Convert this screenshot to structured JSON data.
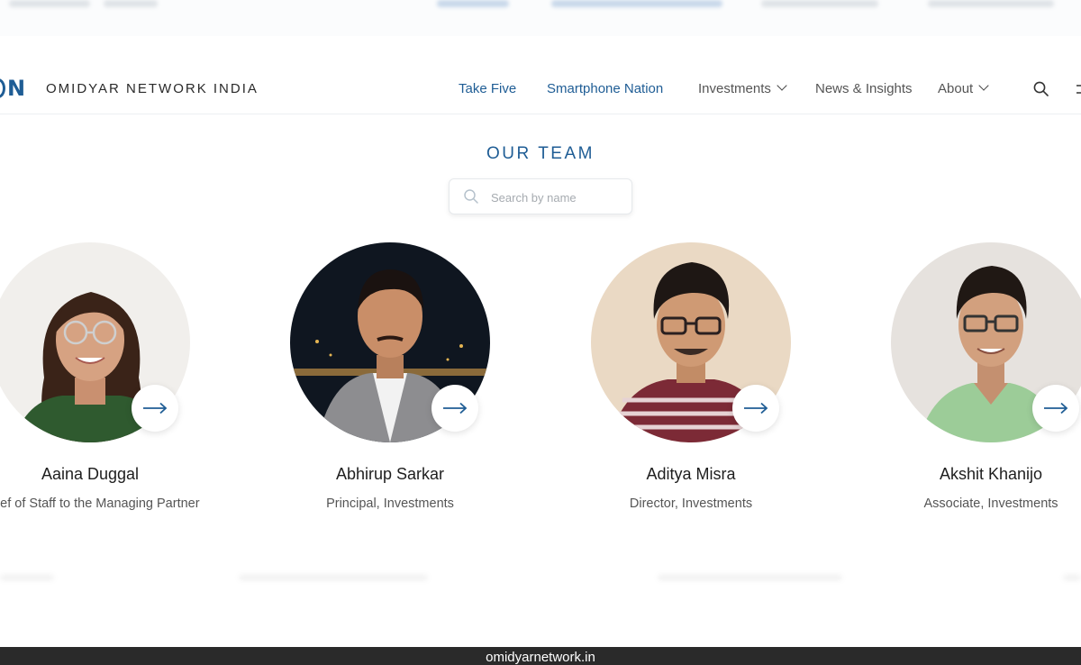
{
  "header": {
    "brand": "OMIDYAR NETWORK INDIA",
    "logo_letter": "N",
    "nav": {
      "take_five": "Take Five",
      "smartphone_nation": "Smartphone Nation",
      "investments": "Investments",
      "news_insights": "News & Insights",
      "about": "About"
    }
  },
  "team": {
    "title": "OUR TEAM",
    "search_placeholder": "Search by name",
    "search_value": "",
    "members": [
      {
        "name": "Aaina Duggal",
        "role": "Chief of Staff to the Managing Partner"
      },
      {
        "name": "Abhirup Sarkar",
        "role": "Principal, Investments"
      },
      {
        "name": "Aditya Misra",
        "role": "Director, Investments"
      },
      {
        "name": "Akshit Khanijo",
        "role": "Associate, Investments"
      }
    ]
  },
  "footer": {
    "domain": "omidyarnetwork.in"
  },
  "colors": {
    "accent": "#1f5d95",
    "footer_bg": "#2a2a2a"
  },
  "icons": [
    "search-icon",
    "chevron-down-icon",
    "menu-icon",
    "arrow-right-icon"
  ]
}
